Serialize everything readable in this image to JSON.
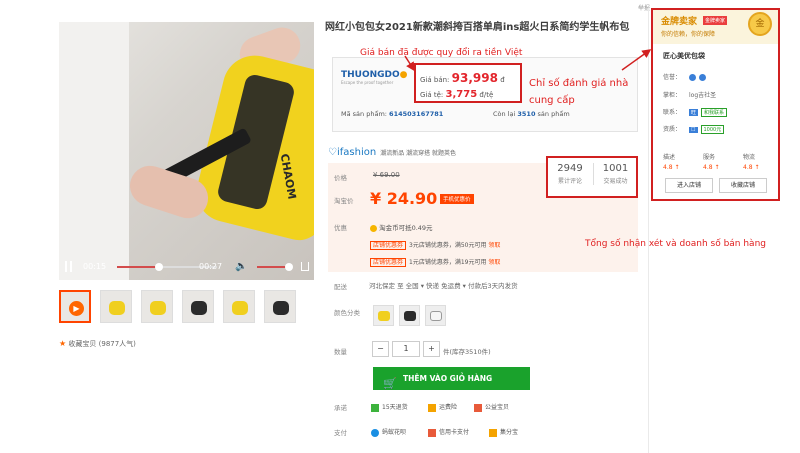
{
  "header": {
    "report": "举报"
  },
  "video": {
    "current_time": "00:15",
    "total_time": "00:27",
    "progress": 0.55,
    "volume": 0.9
  },
  "thumbnails_count": 6,
  "favorite": {
    "label": "收藏宝贝 (9877人气)"
  },
  "product": {
    "title": "网红小包包女2021新款潮斜挎百搭单肩ins超火日系简约学生帆布包",
    "seller_logo": "THUONGDO",
    "seller_logo_sub": "Escape the proof together",
    "price_vnd_label": "Giá bán:",
    "price_vnd_value": "93,998",
    "price_vnd_unit": "đ",
    "rate_label": "Giá tệ:",
    "rate_value": "3,775",
    "rate_unit": "đ/tệ",
    "sku_label": "Mã sản phẩm:",
    "sku_value": "614503167781",
    "stock_label": "Còn lại",
    "stock_value": "3510",
    "stock_unit": "sản phẩm"
  },
  "annotations": {
    "converted_price": "Giá bán đã được quy đổi ra tiền Việt",
    "supplier_rating": "Chỉ số đánh giá nhà cung cấp",
    "reviews_sales": "Tổng số nhận xét và doanh số bán hàng"
  },
  "ifashion": {
    "brand": "ifashion",
    "tagline": "潮流新品 潮流穿搭 就题英色"
  },
  "pricing": {
    "original_label": "价格",
    "original_price": "¥ 69.00",
    "sale_label": "淘宝价",
    "sale_price": "¥ 24.90",
    "mobile_tag": "手机优惠价",
    "discount_label": "优惠",
    "coin_text": "淘金币可抵0.49元",
    "coupons": [
      {
        "tag": "店铺优惠券",
        "text": "3元店铺优惠券，满50元可用",
        "link": "领取"
      },
      {
        "tag": "店铺优惠券",
        "text": "1元店铺优惠券，满19元可用",
        "link": "领取"
      }
    ]
  },
  "stats": {
    "reviews_value": "2949",
    "reviews_label": "累计评论",
    "sales_value": "1001",
    "sales_label": "交易成功"
  },
  "delivery": {
    "label": "配送",
    "text": "河北保定 至  全国 ▾    快递 免运费 ▾    付款后3天内发货"
  },
  "color": {
    "label": "颜色分类"
  },
  "quantity": {
    "label": "数量",
    "value": "1",
    "minus": "−",
    "plus": "+",
    "stock_text": "件(库存3510件)"
  },
  "cart": {
    "label": "THÊM VÀO GIỎ HÀNG"
  },
  "promise": {
    "label": "承诺",
    "items": [
      "15天退货",
      "运费险",
      "公益宝贝"
    ]
  },
  "payment": {
    "label": "支付",
    "items": [
      "蚂蚁花呗",
      "信用卡支付",
      "集分宝"
    ]
  },
  "shop": {
    "gold_title": "金牌卖家",
    "gold_tag": "金牌卖家",
    "gold_sub": "你的信赖，你的保障",
    "medal": "金",
    "name": "匠心美优包袋",
    "rows": [
      {
        "label": "信誉："
      },
      {
        "label": "掌柜：",
        "value": "log吉社圣"
      },
      {
        "label": "联系：",
        "value": "和我联系"
      },
      {
        "label": "资质：",
        "value": "1000元"
      }
    ],
    "scores": [
      {
        "label": "描述",
        "value": "4.8 ↑"
      },
      {
        "label": "服务",
        "value": "4.8 ↑"
      },
      {
        "label": "物流",
        "value": "4.8 ↑"
      }
    ],
    "enter_label": "进入店铺",
    "collect_label": "收藏店铺"
  }
}
